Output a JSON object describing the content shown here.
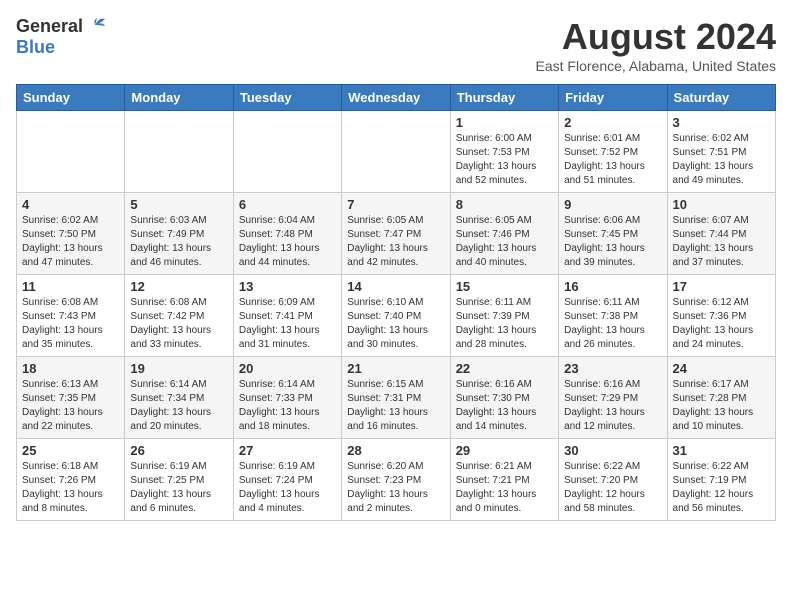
{
  "header": {
    "logo_general": "General",
    "logo_blue": "Blue",
    "month_year": "August 2024",
    "location": "East Florence, Alabama, United States"
  },
  "calendar": {
    "days_of_week": [
      "Sunday",
      "Monday",
      "Tuesday",
      "Wednesday",
      "Thursday",
      "Friday",
      "Saturday"
    ],
    "weeks": [
      [
        {
          "day": "",
          "details": ""
        },
        {
          "day": "",
          "details": ""
        },
        {
          "day": "",
          "details": ""
        },
        {
          "day": "",
          "details": ""
        },
        {
          "day": "1",
          "details": "Sunrise: 6:00 AM\nSunset: 7:53 PM\nDaylight: 13 hours\nand 52 minutes."
        },
        {
          "day": "2",
          "details": "Sunrise: 6:01 AM\nSunset: 7:52 PM\nDaylight: 13 hours\nand 51 minutes."
        },
        {
          "day": "3",
          "details": "Sunrise: 6:02 AM\nSunset: 7:51 PM\nDaylight: 13 hours\nand 49 minutes."
        }
      ],
      [
        {
          "day": "4",
          "details": "Sunrise: 6:02 AM\nSunset: 7:50 PM\nDaylight: 13 hours\nand 47 minutes."
        },
        {
          "day": "5",
          "details": "Sunrise: 6:03 AM\nSunset: 7:49 PM\nDaylight: 13 hours\nand 46 minutes."
        },
        {
          "day": "6",
          "details": "Sunrise: 6:04 AM\nSunset: 7:48 PM\nDaylight: 13 hours\nand 44 minutes."
        },
        {
          "day": "7",
          "details": "Sunrise: 6:05 AM\nSunset: 7:47 PM\nDaylight: 13 hours\nand 42 minutes."
        },
        {
          "day": "8",
          "details": "Sunrise: 6:05 AM\nSunset: 7:46 PM\nDaylight: 13 hours\nand 40 minutes."
        },
        {
          "day": "9",
          "details": "Sunrise: 6:06 AM\nSunset: 7:45 PM\nDaylight: 13 hours\nand 39 minutes."
        },
        {
          "day": "10",
          "details": "Sunrise: 6:07 AM\nSunset: 7:44 PM\nDaylight: 13 hours\nand 37 minutes."
        }
      ],
      [
        {
          "day": "11",
          "details": "Sunrise: 6:08 AM\nSunset: 7:43 PM\nDaylight: 13 hours\nand 35 minutes."
        },
        {
          "day": "12",
          "details": "Sunrise: 6:08 AM\nSunset: 7:42 PM\nDaylight: 13 hours\nand 33 minutes."
        },
        {
          "day": "13",
          "details": "Sunrise: 6:09 AM\nSunset: 7:41 PM\nDaylight: 13 hours\nand 31 minutes."
        },
        {
          "day": "14",
          "details": "Sunrise: 6:10 AM\nSunset: 7:40 PM\nDaylight: 13 hours\nand 30 minutes."
        },
        {
          "day": "15",
          "details": "Sunrise: 6:11 AM\nSunset: 7:39 PM\nDaylight: 13 hours\nand 28 minutes."
        },
        {
          "day": "16",
          "details": "Sunrise: 6:11 AM\nSunset: 7:38 PM\nDaylight: 13 hours\nand 26 minutes."
        },
        {
          "day": "17",
          "details": "Sunrise: 6:12 AM\nSunset: 7:36 PM\nDaylight: 13 hours\nand 24 minutes."
        }
      ],
      [
        {
          "day": "18",
          "details": "Sunrise: 6:13 AM\nSunset: 7:35 PM\nDaylight: 13 hours\nand 22 minutes."
        },
        {
          "day": "19",
          "details": "Sunrise: 6:14 AM\nSunset: 7:34 PM\nDaylight: 13 hours\nand 20 minutes."
        },
        {
          "day": "20",
          "details": "Sunrise: 6:14 AM\nSunset: 7:33 PM\nDaylight: 13 hours\nand 18 minutes."
        },
        {
          "day": "21",
          "details": "Sunrise: 6:15 AM\nSunset: 7:31 PM\nDaylight: 13 hours\nand 16 minutes."
        },
        {
          "day": "22",
          "details": "Sunrise: 6:16 AM\nSunset: 7:30 PM\nDaylight: 13 hours\nand 14 minutes."
        },
        {
          "day": "23",
          "details": "Sunrise: 6:16 AM\nSunset: 7:29 PM\nDaylight: 13 hours\nand 12 minutes."
        },
        {
          "day": "24",
          "details": "Sunrise: 6:17 AM\nSunset: 7:28 PM\nDaylight: 13 hours\nand 10 minutes."
        }
      ],
      [
        {
          "day": "25",
          "details": "Sunrise: 6:18 AM\nSunset: 7:26 PM\nDaylight: 13 hours\nand 8 minutes."
        },
        {
          "day": "26",
          "details": "Sunrise: 6:19 AM\nSunset: 7:25 PM\nDaylight: 13 hours\nand 6 minutes."
        },
        {
          "day": "27",
          "details": "Sunrise: 6:19 AM\nSunset: 7:24 PM\nDaylight: 13 hours\nand 4 minutes."
        },
        {
          "day": "28",
          "details": "Sunrise: 6:20 AM\nSunset: 7:23 PM\nDaylight: 13 hours\nand 2 minutes."
        },
        {
          "day": "29",
          "details": "Sunrise: 6:21 AM\nSunset: 7:21 PM\nDaylight: 13 hours\nand 0 minutes."
        },
        {
          "day": "30",
          "details": "Sunrise: 6:22 AM\nSunset: 7:20 PM\nDaylight: 12 hours\nand 58 minutes."
        },
        {
          "day": "31",
          "details": "Sunrise: 6:22 AM\nSunset: 7:19 PM\nDaylight: 12 hours\nand 56 minutes."
        }
      ]
    ]
  }
}
